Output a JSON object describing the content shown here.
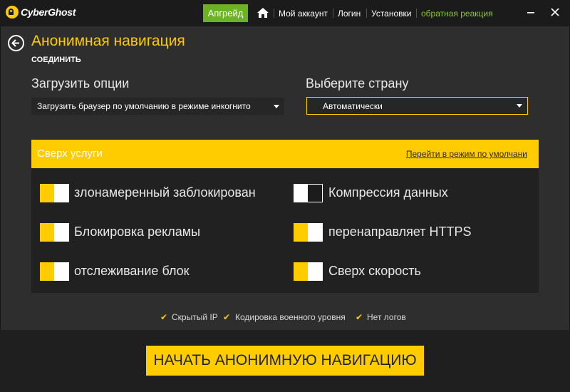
{
  "app": {
    "logo_text": "CyberGhost"
  },
  "titlebar": {
    "upgrade_label": "Апгрейд",
    "nav": {
      "account": "Мой аккаунт",
      "login": "Логин",
      "settings": "Установки",
      "feedback": "обратная реакция"
    }
  },
  "header": {
    "title": "Анонимная навигация",
    "subtitle": "СОЕДИНИТЬ"
  },
  "options": {
    "load_label": "Загрузить опции",
    "load_value": "Загрузить браузер по умолчанию в режиме инкогнито",
    "country_label": "Выберите страну",
    "country_value": "Автоматически"
  },
  "services": {
    "title": "Сверх услуги",
    "default_link": "Перейти в режим по умолчани",
    "items": [
      {
        "label": "злонамеренный заблокирован",
        "enabled": true
      },
      {
        "label": "Компрессия данных",
        "enabled": false
      },
      {
        "label": "Блокировка рекламы",
        "enabled": true
      },
      {
        "label": "перенаправляет HTTPS",
        "enabled": true
      },
      {
        "label": "отслеживание блок",
        "enabled": true
      },
      {
        "label": "Сверх скорость",
        "enabled": true
      }
    ]
  },
  "features": {
    "check_glyph": "✔",
    "hidden_ip": "Скрытый IP",
    "encryption": "Кодировка военного уровня",
    "no_logs": "Нет логов"
  },
  "start_button": "НАЧАТЬ АНОНИМНУЮ НАВИГАЦИЮ",
  "colors": {
    "accent": "#ffcc00",
    "upgrade": "#6bb324",
    "feedback": "#8cc63f",
    "background": "#2e2e2e"
  }
}
